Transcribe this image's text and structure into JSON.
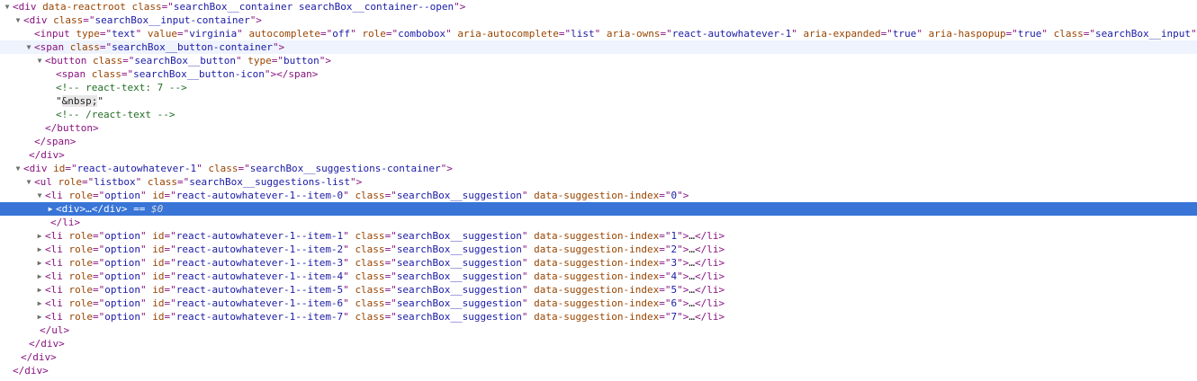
{
  "lines": [
    {
      "indent": 0,
      "tri": "down",
      "parts": [
        [
          "tag",
          "<div "
        ],
        [
          "attr",
          "data-reactroot "
        ],
        [
          "attr",
          "class"
        ],
        [
          "tag",
          "=\""
        ],
        [
          "val",
          "searchBox__container searchBox__container--open"
        ],
        [
          "tag",
          "\">"
        ]
      ]
    },
    {
      "indent": 1,
      "tri": "down",
      "parts": [
        [
          "tag",
          "<div "
        ],
        [
          "attr",
          "class"
        ],
        [
          "tag",
          "=\""
        ],
        [
          "val",
          "searchBox__input-container"
        ],
        [
          "tag",
          "\">"
        ]
      ]
    },
    {
      "indent": 2,
      "tri": "none",
      "parts": [
        [
          "tag",
          "<input "
        ],
        [
          "attr",
          "type"
        ],
        [
          "tag",
          "=\""
        ],
        [
          "val",
          "text"
        ],
        [
          "tag",
          "\" "
        ],
        [
          "attr",
          "value"
        ],
        [
          "tag",
          "=\""
        ],
        [
          "val",
          "virginia"
        ],
        [
          "tag",
          "\" "
        ],
        [
          "attr",
          "autocomplete"
        ],
        [
          "tag",
          "=\""
        ],
        [
          "val",
          "off"
        ],
        [
          "tag",
          "\" "
        ],
        [
          "attr",
          "role"
        ],
        [
          "tag",
          "=\""
        ],
        [
          "val",
          "combobox"
        ],
        [
          "tag",
          "\" "
        ],
        [
          "attr",
          "aria-autocomplete"
        ],
        [
          "tag",
          "=\""
        ],
        [
          "val",
          "list"
        ],
        [
          "tag",
          "\" "
        ],
        [
          "attr",
          "aria-owns"
        ],
        [
          "tag",
          "=\""
        ],
        [
          "val",
          "react-autowhatever-1"
        ],
        [
          "tag",
          "\" "
        ],
        [
          "attr",
          "aria-expanded"
        ],
        [
          "tag",
          "=\""
        ],
        [
          "val",
          "true"
        ],
        [
          "tag",
          "\" "
        ],
        [
          "attr",
          "aria-haspopup"
        ],
        [
          "tag",
          "=\""
        ],
        [
          "val",
          "true"
        ],
        [
          "tag",
          "\" "
        ],
        [
          "attr",
          "class"
        ],
        [
          "tag",
          "=\""
        ],
        [
          "val",
          "searchBox__input"
        ],
        [
          "tag",
          "\""
        ]
      ]
    },
    {
      "indent": 2,
      "tri": "down",
      "hover": true,
      "parts": [
        [
          "tag",
          "<span "
        ],
        [
          "attr",
          "class"
        ],
        [
          "tag",
          "=\""
        ],
        [
          "val",
          "searchBox__button-container"
        ],
        [
          "tag",
          "\">"
        ]
      ]
    },
    {
      "indent": 3,
      "tri": "down",
      "parts": [
        [
          "tag",
          "<button "
        ],
        [
          "attr",
          "class"
        ],
        [
          "tag",
          "=\""
        ],
        [
          "val",
          "searchBox__button"
        ],
        [
          "tag",
          "\" "
        ],
        [
          "attr",
          "type"
        ],
        [
          "tag",
          "=\""
        ],
        [
          "val",
          "button"
        ],
        [
          "tag",
          "\">"
        ]
      ]
    },
    {
      "indent": 4,
      "tri": "none",
      "parts": [
        [
          "tag",
          "<span "
        ],
        [
          "attr",
          "class"
        ],
        [
          "tag",
          "=\""
        ],
        [
          "val",
          "searchBox__button-icon"
        ],
        [
          "tag",
          "\"></span>"
        ]
      ]
    },
    {
      "indent": 4,
      "tri": "none",
      "parts": [
        [
          "cmt",
          "<!-- react-text: 7 -->"
        ]
      ]
    },
    {
      "indent": 4,
      "tri": "none",
      "parts": [
        [
          "txt",
          "\""
        ],
        [
          "nbsp",
          "&nbsp;"
        ],
        [
          "txt",
          "\""
        ]
      ]
    },
    {
      "indent": 4,
      "tri": "none",
      "parts": [
        [
          "cmt",
          "<!-- /react-text -->"
        ]
      ]
    },
    {
      "indent": 3,
      "tri": "none",
      "parts": [
        [
          "tag",
          "</button>"
        ]
      ]
    },
    {
      "indent": 2,
      "tri": "none",
      "parts": [
        [
          "tag",
          "</span>"
        ]
      ]
    },
    {
      "indent": 1.5,
      "tri": "none",
      "parts": [
        [
          "tag",
          "</div>"
        ]
      ]
    },
    {
      "indent": 1,
      "tri": "down",
      "parts": [
        [
          "tag",
          "<div "
        ],
        [
          "attr",
          "id"
        ],
        [
          "tag",
          "=\""
        ],
        [
          "val",
          "react-autowhatever-1"
        ],
        [
          "tag",
          "\" "
        ],
        [
          "attr",
          "class"
        ],
        [
          "tag",
          "=\""
        ],
        [
          "val",
          "searchBox__suggestions-container"
        ],
        [
          "tag",
          "\">"
        ]
      ]
    },
    {
      "indent": 2,
      "tri": "down",
      "parts": [
        [
          "tag",
          "<ul "
        ],
        [
          "attr",
          "role"
        ],
        [
          "tag",
          "=\""
        ],
        [
          "val",
          "listbox"
        ],
        [
          "tag",
          "\" "
        ],
        [
          "attr",
          "class"
        ],
        [
          "tag",
          "=\""
        ],
        [
          "val",
          "searchBox__suggestions-list"
        ],
        [
          "tag",
          "\">"
        ]
      ]
    },
    {
      "indent": 3,
      "tri": "down",
      "parts": [
        [
          "tag",
          "<li "
        ],
        [
          "attr",
          "role"
        ],
        [
          "tag",
          "=\""
        ],
        [
          "val",
          "option"
        ],
        [
          "tag",
          "\" "
        ],
        [
          "attr",
          "id"
        ],
        [
          "tag",
          "=\""
        ],
        [
          "val",
          "react-autowhatever-1--item-0"
        ],
        [
          "tag",
          "\" "
        ],
        [
          "attr",
          "class"
        ],
        [
          "tag",
          "=\""
        ],
        [
          "val",
          "searchBox__suggestion"
        ],
        [
          "tag",
          "\" "
        ],
        [
          "attr",
          "data-suggestion-index"
        ],
        [
          "tag",
          "=\""
        ],
        [
          "val",
          "0"
        ],
        [
          "tag",
          "\">"
        ]
      ]
    },
    {
      "indent": 4,
      "tri": "right",
      "selected": true,
      "parts": [
        [
          "tag",
          "<div>"
        ],
        [
          "ell",
          "…"
        ],
        [
          "tag",
          "</div>"
        ],
        [
          "eq",
          " == "
        ],
        [
          "dollar",
          "$0"
        ]
      ]
    },
    {
      "indent": 3.5,
      "tri": "none",
      "parts": [
        [
          "tag",
          "</li>"
        ]
      ]
    },
    {
      "indent": 3,
      "tri": "right",
      "parts": [
        [
          "tag",
          "<li "
        ],
        [
          "attr",
          "role"
        ],
        [
          "tag",
          "=\""
        ],
        [
          "val",
          "option"
        ],
        [
          "tag",
          "\" "
        ],
        [
          "attr",
          "id"
        ],
        [
          "tag",
          "=\""
        ],
        [
          "val",
          "react-autowhatever-1--item-1"
        ],
        [
          "tag",
          "\" "
        ],
        [
          "attr",
          "class"
        ],
        [
          "tag",
          "=\""
        ],
        [
          "val",
          "searchBox__suggestion"
        ],
        [
          "tag",
          "\" "
        ],
        [
          "attr",
          "data-suggestion-index"
        ],
        [
          "tag",
          "=\""
        ],
        [
          "val",
          "1"
        ],
        [
          "tag",
          "\">"
        ],
        [
          "ell",
          "…"
        ],
        [
          "tag",
          "</li>"
        ]
      ]
    },
    {
      "indent": 3,
      "tri": "right",
      "parts": [
        [
          "tag",
          "<li "
        ],
        [
          "attr",
          "role"
        ],
        [
          "tag",
          "=\""
        ],
        [
          "val",
          "option"
        ],
        [
          "tag",
          "\" "
        ],
        [
          "attr",
          "id"
        ],
        [
          "tag",
          "=\""
        ],
        [
          "val",
          "react-autowhatever-1--item-2"
        ],
        [
          "tag",
          "\" "
        ],
        [
          "attr",
          "class"
        ],
        [
          "tag",
          "=\""
        ],
        [
          "val",
          "searchBox__suggestion"
        ],
        [
          "tag",
          "\" "
        ],
        [
          "attr",
          "data-suggestion-index"
        ],
        [
          "tag",
          "=\""
        ],
        [
          "val",
          "2"
        ],
        [
          "tag",
          "\">"
        ],
        [
          "ell",
          "…"
        ],
        [
          "tag",
          "</li>"
        ]
      ]
    },
    {
      "indent": 3,
      "tri": "right",
      "parts": [
        [
          "tag",
          "<li "
        ],
        [
          "attr",
          "role"
        ],
        [
          "tag",
          "=\""
        ],
        [
          "val",
          "option"
        ],
        [
          "tag",
          "\" "
        ],
        [
          "attr",
          "id"
        ],
        [
          "tag",
          "=\""
        ],
        [
          "val",
          "react-autowhatever-1--item-3"
        ],
        [
          "tag",
          "\" "
        ],
        [
          "attr",
          "class"
        ],
        [
          "tag",
          "=\""
        ],
        [
          "val",
          "searchBox__suggestion"
        ],
        [
          "tag",
          "\" "
        ],
        [
          "attr",
          "data-suggestion-index"
        ],
        [
          "tag",
          "=\""
        ],
        [
          "val",
          "3"
        ],
        [
          "tag",
          "\">"
        ],
        [
          "ell",
          "…"
        ],
        [
          "tag",
          "</li>"
        ]
      ]
    },
    {
      "indent": 3,
      "tri": "right",
      "parts": [
        [
          "tag",
          "<li "
        ],
        [
          "attr",
          "role"
        ],
        [
          "tag",
          "=\""
        ],
        [
          "val",
          "option"
        ],
        [
          "tag",
          "\" "
        ],
        [
          "attr",
          "id"
        ],
        [
          "tag",
          "=\""
        ],
        [
          "val",
          "react-autowhatever-1--item-4"
        ],
        [
          "tag",
          "\" "
        ],
        [
          "attr",
          "class"
        ],
        [
          "tag",
          "=\""
        ],
        [
          "val",
          "searchBox__suggestion"
        ],
        [
          "tag",
          "\" "
        ],
        [
          "attr",
          "data-suggestion-index"
        ],
        [
          "tag",
          "=\""
        ],
        [
          "val",
          "4"
        ],
        [
          "tag",
          "\">"
        ],
        [
          "ell",
          "…"
        ],
        [
          "tag",
          "</li>"
        ]
      ]
    },
    {
      "indent": 3,
      "tri": "right",
      "parts": [
        [
          "tag",
          "<li "
        ],
        [
          "attr",
          "role"
        ],
        [
          "tag",
          "=\""
        ],
        [
          "val",
          "option"
        ],
        [
          "tag",
          "\" "
        ],
        [
          "attr",
          "id"
        ],
        [
          "tag",
          "=\""
        ],
        [
          "val",
          "react-autowhatever-1--item-5"
        ],
        [
          "tag",
          "\" "
        ],
        [
          "attr",
          "class"
        ],
        [
          "tag",
          "=\""
        ],
        [
          "val",
          "searchBox__suggestion"
        ],
        [
          "tag",
          "\" "
        ],
        [
          "attr",
          "data-suggestion-index"
        ],
        [
          "tag",
          "=\""
        ],
        [
          "val",
          "5"
        ],
        [
          "tag",
          "\">"
        ],
        [
          "ell",
          "…"
        ],
        [
          "tag",
          "</li>"
        ]
      ]
    },
    {
      "indent": 3,
      "tri": "right",
      "parts": [
        [
          "tag",
          "<li "
        ],
        [
          "attr",
          "role"
        ],
        [
          "tag",
          "=\""
        ],
        [
          "val",
          "option"
        ],
        [
          "tag",
          "\" "
        ],
        [
          "attr",
          "id"
        ],
        [
          "tag",
          "=\""
        ],
        [
          "val",
          "react-autowhatever-1--item-6"
        ],
        [
          "tag",
          "\" "
        ],
        [
          "attr",
          "class"
        ],
        [
          "tag",
          "=\""
        ],
        [
          "val",
          "searchBox__suggestion"
        ],
        [
          "tag",
          "\" "
        ],
        [
          "attr",
          "data-suggestion-index"
        ],
        [
          "tag",
          "=\""
        ],
        [
          "val",
          "6"
        ],
        [
          "tag",
          "\">"
        ],
        [
          "ell",
          "…"
        ],
        [
          "tag",
          "</li>"
        ]
      ]
    },
    {
      "indent": 3,
      "tri": "right",
      "parts": [
        [
          "tag",
          "<li "
        ],
        [
          "attr",
          "role"
        ],
        [
          "tag",
          "=\""
        ],
        [
          "val",
          "option"
        ],
        [
          "tag",
          "\" "
        ],
        [
          "attr",
          "id"
        ],
        [
          "tag",
          "=\""
        ],
        [
          "val",
          "react-autowhatever-1--item-7"
        ],
        [
          "tag",
          "\" "
        ],
        [
          "attr",
          "class"
        ],
        [
          "tag",
          "=\""
        ],
        [
          "val",
          "searchBox__suggestion"
        ],
        [
          "tag",
          "\" "
        ],
        [
          "attr",
          "data-suggestion-index"
        ],
        [
          "tag",
          "=\""
        ],
        [
          "val",
          "7"
        ],
        [
          "tag",
          "\">"
        ],
        [
          "ell",
          "…"
        ],
        [
          "tag",
          "</li>"
        ]
      ]
    },
    {
      "indent": 2.5,
      "tri": "none",
      "parts": [
        [
          "tag",
          "</ul>"
        ]
      ]
    },
    {
      "indent": 1.5,
      "tri": "none",
      "parts": [
        [
          "tag",
          "</div>"
        ]
      ]
    },
    {
      "indent": 0.75,
      "tri": "none",
      "parts": [
        [
          "tag",
          "</div>"
        ]
      ]
    },
    {
      "indent": 0,
      "tri": "none",
      "parts": [
        [
          "tag",
          "</div>"
        ]
      ]
    }
  ]
}
